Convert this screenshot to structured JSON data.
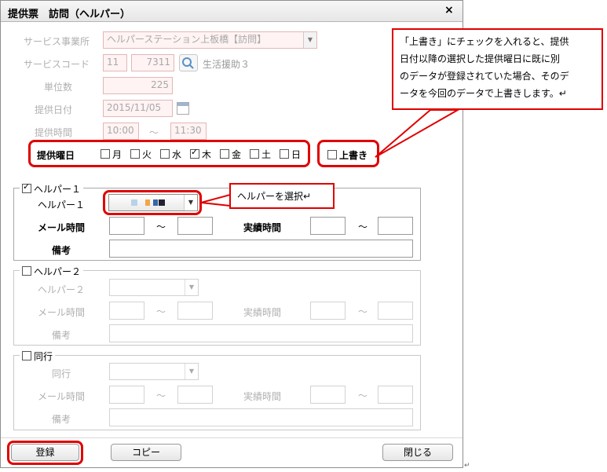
{
  "window": {
    "title": "提供票　訪問（ヘルパー）",
    "close": "×"
  },
  "header": {
    "service_provider_label": "サービス事業所",
    "service_provider_value": "ヘルパーステーション上板橋【訪問】",
    "service_code_label": "サービスコード",
    "service_code_1": "11",
    "service_code_2": "7311",
    "service_name": "生活援助３",
    "units_label": "単位数",
    "units_value": "225",
    "date_label": "提供日付",
    "date_value": "2015/11/05",
    "time_label": "提供時間",
    "time_start": "10:00",
    "time_tilde": "〜",
    "time_end": "11:30"
  },
  "weekdays": {
    "label": "提供曜日",
    "days": [
      {
        "label": "月",
        "checked": false
      },
      {
        "label": "火",
        "checked": false
      },
      {
        "label": "水",
        "checked": false
      },
      {
        "label": "木",
        "checked": true
      },
      {
        "label": "金",
        "checked": false
      },
      {
        "label": "土",
        "checked": false
      },
      {
        "label": "日",
        "checked": false
      }
    ],
    "overwrite_label": "上書き"
  },
  "helper1": {
    "legend": "ヘルパー１",
    "checked": true,
    "select_label": "ヘルパー１",
    "mail_time_label": "メール時間",
    "tilde": "〜",
    "actual_time_label": "実績時間",
    "remarks_label": "備考"
  },
  "helper2": {
    "legend": "ヘルパー２",
    "checked": false,
    "select_label": "ヘルパー２",
    "mail_time_label": "メール時間",
    "tilde": "〜",
    "actual_time_label": "実績時間",
    "remarks_label": "備考"
  },
  "companion": {
    "legend": "同行",
    "checked": false,
    "select_label": "同行",
    "mail_time_label": "メール時間",
    "tilde": "〜",
    "actual_time_label": "実績時間",
    "remarks_label": "備考"
  },
  "footer": {
    "register": "登録",
    "copy": "コピー",
    "close": "閉じる"
  },
  "annotations": {
    "overwrite_note_lines": [
      "「上書き」にチェックを入れると、提供",
      "日付以降の選択した提供曜日に既に別",
      "のデータが登録されていた場合、そのデ",
      "ータを今回のデータで上書きします。↵"
    ],
    "helper_note": "ヘルパーを選択↵",
    "return_mark": "↵"
  },
  "colors": {
    "highlight": "#e00000",
    "disabled_field_bg": "#fff3f3",
    "disabled_field_border": "#e3b7b7"
  }
}
